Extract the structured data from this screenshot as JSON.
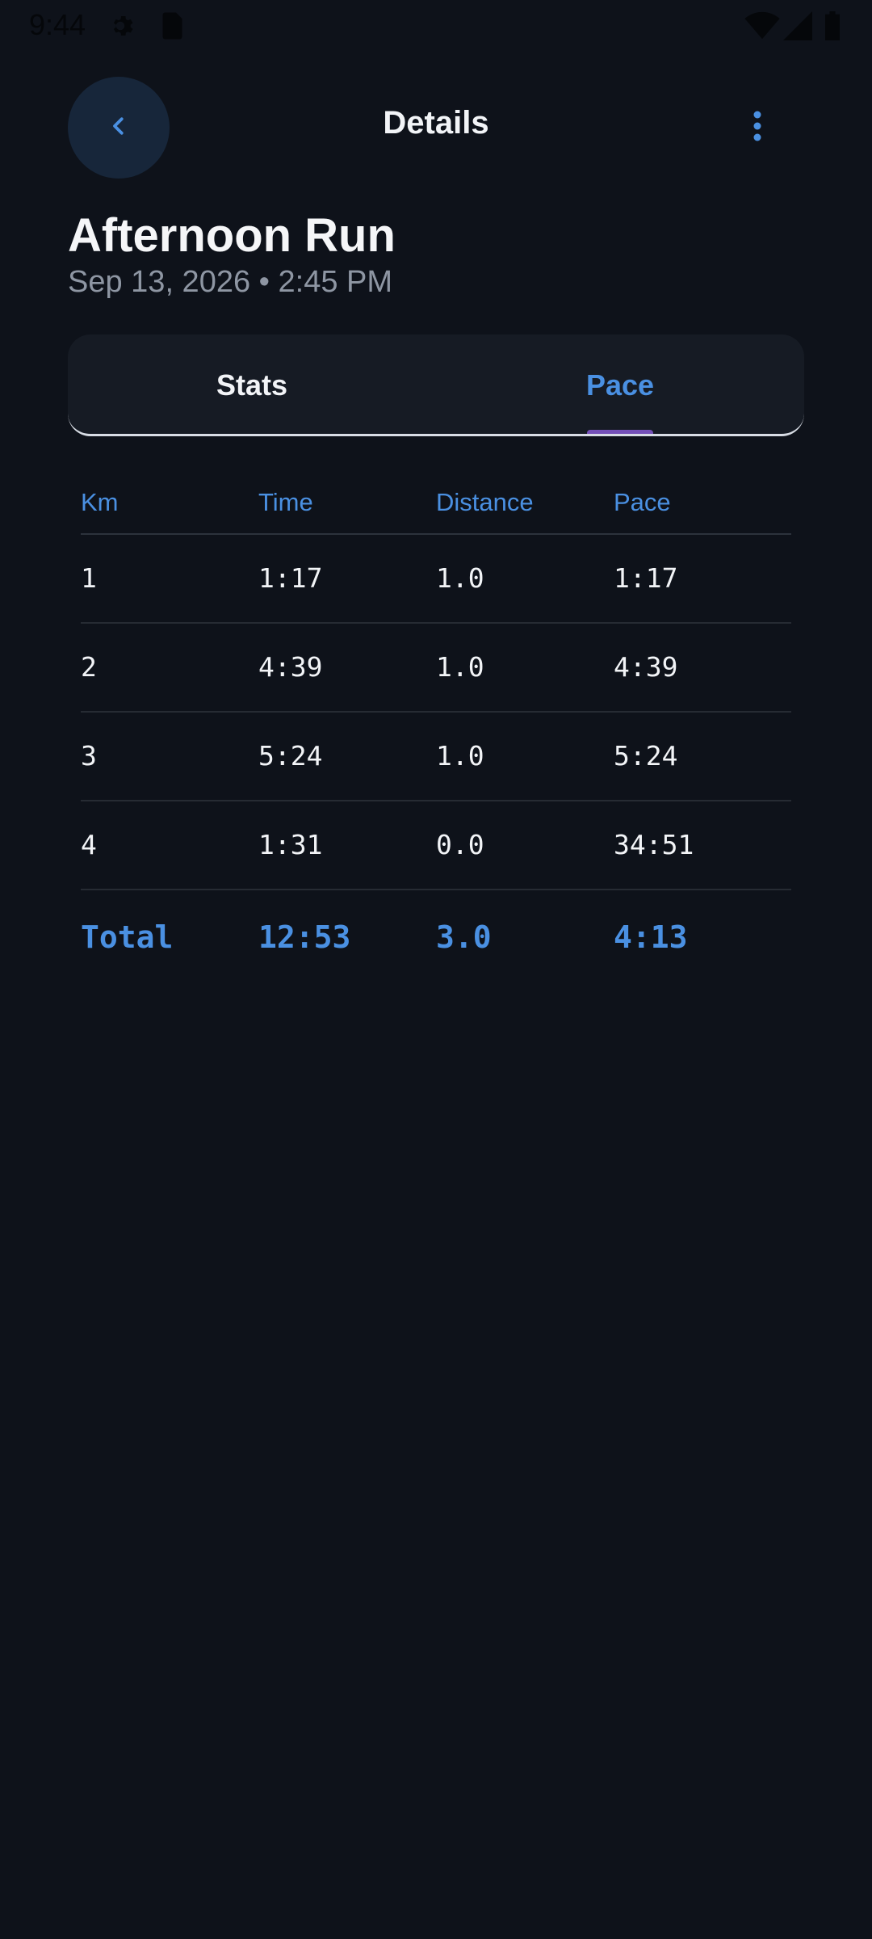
{
  "status_bar": {
    "time": "9:44"
  },
  "header": {
    "title": "Details"
  },
  "activity": {
    "title": "Afternoon Run",
    "date": "Sep 13, 2026 • 2:45 PM"
  },
  "tabs": [
    {
      "label": "Stats",
      "active": false
    },
    {
      "label": "Pace",
      "active": true
    }
  ],
  "table": {
    "columns": [
      "Km",
      "Time",
      "Distance",
      "Pace"
    ],
    "rows": [
      [
        "1",
        "1:17",
        "1.0",
        "1:17"
      ],
      [
        "2",
        "4:39",
        "1.0",
        "4:39"
      ],
      [
        "3",
        "5:24",
        "1.0",
        "5:24"
      ],
      [
        "4",
        "1:31",
        "0.0",
        "34:51"
      ]
    ],
    "total": [
      "Total",
      "12:53",
      "3.0",
      "4:13"
    ]
  },
  "icons": {
    "back": "chevron-left-icon",
    "more": "more-vertical-icon",
    "settings": "gear-icon",
    "sim": "sim-card-icon",
    "wifi": "wifi-icon",
    "signal": "signal-icon",
    "battery": "battery-icon"
  },
  "colors": {
    "background": "#0e121a",
    "accent": "#4a90e2",
    "tab_indicator": "#7450b8",
    "back_button_bg": "#17263a"
  }
}
